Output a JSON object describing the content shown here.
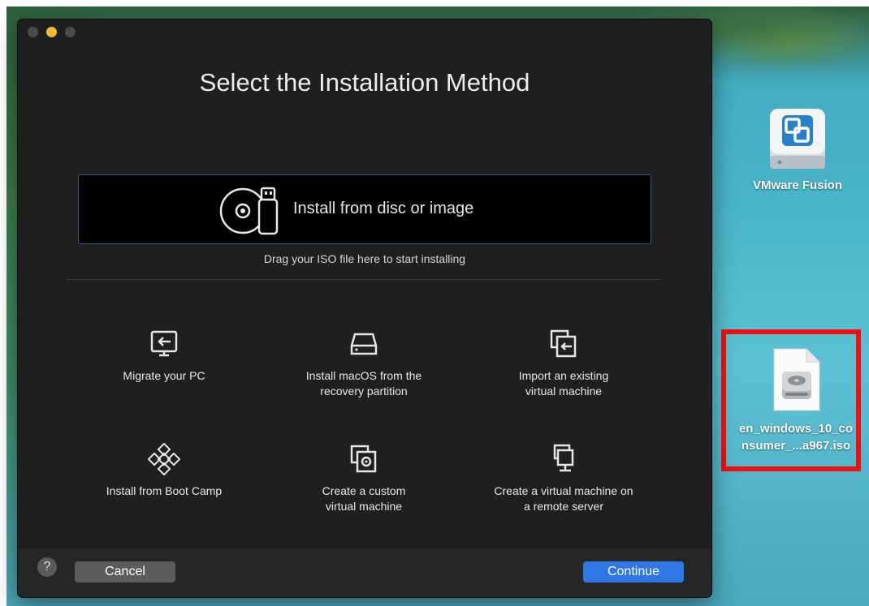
{
  "window": {
    "title": "Select the Installation Method"
  },
  "drop_zone": {
    "label": "Install from disc or image",
    "hint": "Drag your ISO file here to start installing"
  },
  "options": [
    {
      "label1": "Migrate your PC",
      "label2": "",
      "icon": "migrate-pc-icon"
    },
    {
      "label1": "Install macOS from the",
      "label2": "recovery partition",
      "icon": "drive-icon"
    },
    {
      "label1": "Import an existing",
      "label2": "virtual machine",
      "icon": "import-vm-icon"
    },
    {
      "label1": "Install from Boot Camp",
      "label2": "",
      "icon": "boot-camp-icon"
    },
    {
      "label1": "Create a custom",
      "label2": "virtual machine",
      "icon": "custom-vm-icon"
    },
    {
      "label1": "Create a virtual machine on",
      "label2": "a remote server",
      "icon": "remote-server-icon"
    }
  ],
  "footer": {
    "help": "?",
    "cancel": "Cancel",
    "continue": "Continue"
  },
  "desktop": {
    "vmware_label": "VMware Fusion",
    "iso_label_line1": "en_windows_10_co",
    "iso_label_line2": "nsumer_...a967.iso"
  },
  "colors": {
    "accent": "#2f78e4",
    "highlight": "#ee1111",
    "traffic_minimize": "#f4b92f"
  }
}
